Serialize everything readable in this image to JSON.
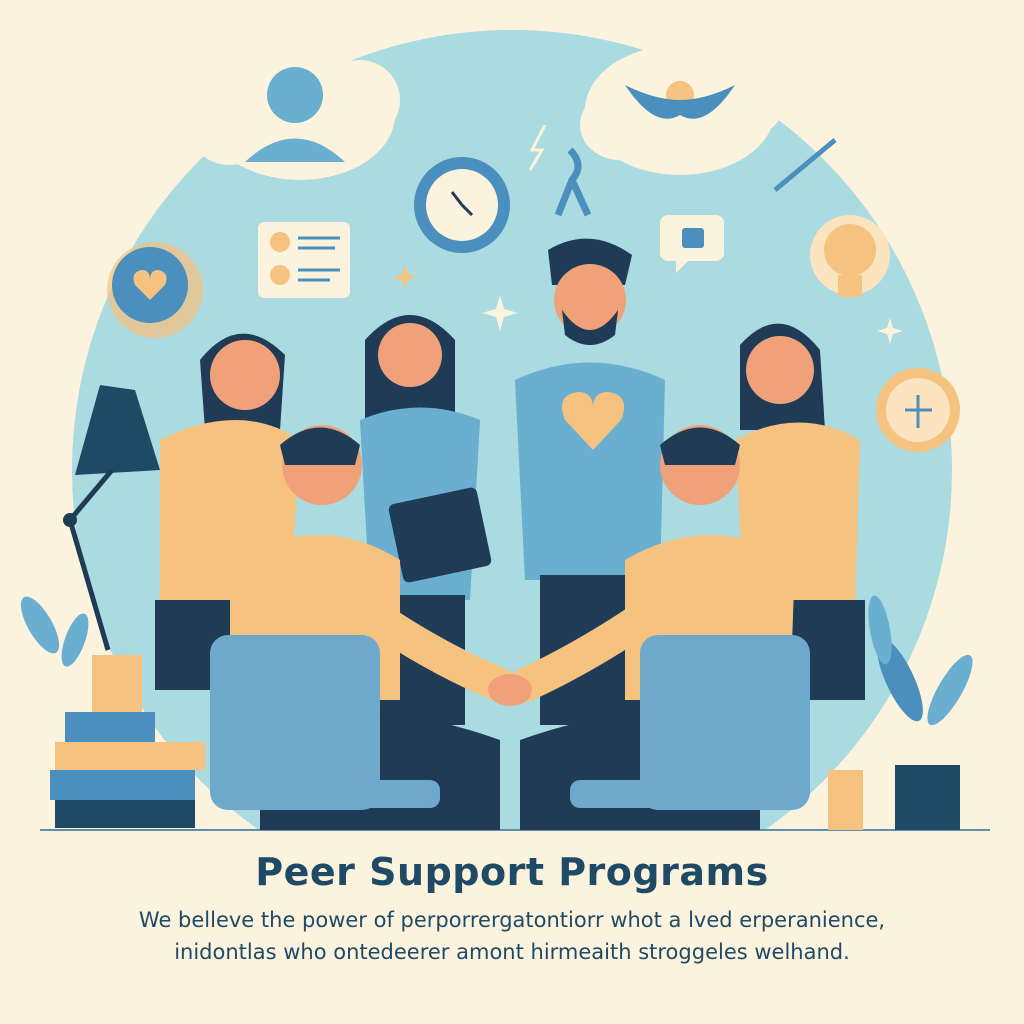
{
  "title": "Peer Support Programs",
  "body": {
    "line1": "We belleve the power of perporrergatontiorr whot a lved erperanience,",
    "line2": "inidontlas who ontedeerer amont hirmeaith stroggeles welhand."
  },
  "colors": {
    "background": "#fbf3dd",
    "circle": "#a9dbe0",
    "sweater_orange": "#f6c27f",
    "shirt_blue": "#6aaed0",
    "chair_blue": "#6ea9cc",
    "navy": "#1f3b56",
    "title_navy": "#1f4a66"
  },
  "icons": [
    "person-bust-icon",
    "winged-emblem-icon",
    "clock-icon",
    "lightbulb-icon",
    "heart-badge-icon",
    "chat-card-icon",
    "awareness-ribbon-icon",
    "desk-lamp-icon",
    "plant-icon",
    "book-stack-icon",
    "sparkle-icon",
    "lightning-icon",
    "pencil-icon",
    "speech-bubble-icon",
    "coin-icon"
  ]
}
